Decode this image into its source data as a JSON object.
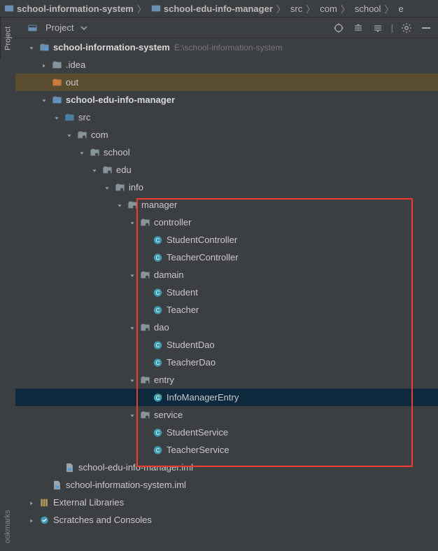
{
  "breadcrumbs": [
    "school-information-system",
    "school-edu-info-manager",
    "src",
    "com",
    "school",
    "e"
  ],
  "toolwindow": {
    "title": "Project"
  },
  "vertical_tabs": {
    "project": "Project",
    "bookmarks": "ookmarks"
  },
  "tree": [
    {
      "d": 0,
      "exp": "down",
      "icon": "module",
      "label": "school-information-system",
      "bold": true,
      "hint": "E:\\school-information-system"
    },
    {
      "d": 1,
      "exp": "right",
      "icon": "folder",
      "label": ".idea"
    },
    {
      "d": 1,
      "exp": "none",
      "icon": "folder-orange",
      "label": "out",
      "sel": "out"
    },
    {
      "d": 1,
      "exp": "down",
      "icon": "module",
      "label": "school-edu-info-manager",
      "bold": true
    },
    {
      "d": 2,
      "exp": "down",
      "icon": "folder-src",
      "label": "src"
    },
    {
      "d": 3,
      "exp": "down",
      "icon": "package",
      "label": "com"
    },
    {
      "d": 4,
      "exp": "down",
      "icon": "package",
      "label": "school"
    },
    {
      "d": 5,
      "exp": "down",
      "icon": "package",
      "label": "edu"
    },
    {
      "d": 6,
      "exp": "down",
      "icon": "package",
      "label": "info"
    },
    {
      "d": 7,
      "exp": "down",
      "icon": "package",
      "label": "manager"
    },
    {
      "d": 8,
      "exp": "down",
      "icon": "package",
      "label": "controller"
    },
    {
      "d": 9,
      "exp": "none",
      "icon": "class",
      "label": "StudentController"
    },
    {
      "d": 9,
      "exp": "none",
      "icon": "class",
      "label": "TeacherController"
    },
    {
      "d": 8,
      "exp": "down",
      "icon": "package",
      "label": "damain"
    },
    {
      "d": 9,
      "exp": "none",
      "icon": "class",
      "label": "Student"
    },
    {
      "d": 9,
      "exp": "none",
      "icon": "class",
      "label": "Teacher"
    },
    {
      "d": 8,
      "exp": "down",
      "icon": "package",
      "label": "dao"
    },
    {
      "d": 9,
      "exp": "none",
      "icon": "class",
      "label": "StudentDao"
    },
    {
      "d": 9,
      "exp": "none",
      "icon": "class",
      "label": "TeacherDao"
    },
    {
      "d": 8,
      "exp": "down",
      "icon": "package",
      "label": "entry"
    },
    {
      "d": 9,
      "exp": "none",
      "icon": "class-run",
      "label": "InfoManagerEntry",
      "sel": "entry"
    },
    {
      "d": 8,
      "exp": "down",
      "icon": "package",
      "label": "service"
    },
    {
      "d": 9,
      "exp": "none",
      "icon": "class",
      "label": "StudentService"
    },
    {
      "d": 9,
      "exp": "none",
      "icon": "class",
      "label": "TeacherService"
    },
    {
      "d": 2,
      "exp": "none",
      "icon": "iml",
      "label": "school-edu-info-manager.iml"
    },
    {
      "d": 1,
      "exp": "none",
      "icon": "iml",
      "label": "school-information-system.iml"
    },
    {
      "d": 0,
      "exp": "right",
      "icon": "libs",
      "label": "External Libraries"
    },
    {
      "d": 0,
      "exp": "right",
      "icon": "scratch",
      "label": "Scratches and Consoles"
    }
  ],
  "colors": {
    "folder": "#87939a",
    "folder_orange": "#c87b3c",
    "folder_src": "#4a7fa5",
    "module": "#6a8fb5",
    "package": "#87939a",
    "class": "#3b9eb5",
    "iml": "#9aa7b0",
    "libs": "#b39c5a",
    "scratch": "#3b9eb5"
  }
}
